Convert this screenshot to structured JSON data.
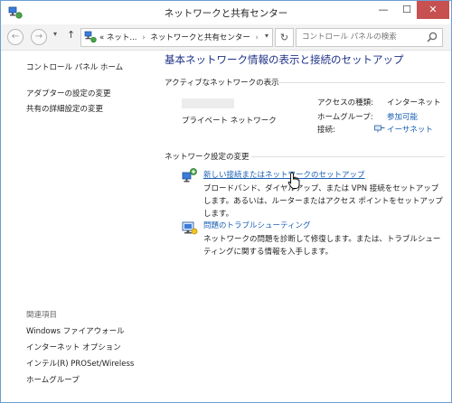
{
  "window": {
    "title": "ネットワークと共有センター",
    "minimize": "—",
    "maximize": "☐",
    "close": "✕"
  },
  "addressbar": {
    "back": "←",
    "forward": "→",
    "recent": "▾",
    "up": "↑",
    "path_prefix": "«",
    "path_segments": [
      "ネット...",
      "ネットワークと共有センター"
    ],
    "path_separator": "›",
    "path_dropdown": "▾",
    "refresh": "↻",
    "search_placeholder": "コントロール パネルの検索"
  },
  "sidebar": {
    "home": "コントロール パネル ホーム",
    "links": [
      "アダプターの設定の変更",
      "共有の詳細設定の変更"
    ],
    "related_heading": "関連項目",
    "related": [
      "Windows ファイアウォール",
      "インターネット オプション",
      "インテル(R) PROSet/Wireless",
      "ホームグループ"
    ]
  },
  "main": {
    "title": "基本ネットワーク情報の表示と接続のセットアップ",
    "active_heading": "アクティブなネットワークの表示",
    "network_type": "プライベート ネットワーク",
    "access_type_label": "アクセスの種類:",
    "access_type_value": "インターネット",
    "homegroup_label": "ホームグループ:",
    "homegroup_value": "参加可能",
    "connection_label": "接続:",
    "connection_value": "イーサネット",
    "change_heading": "ネットワーク設定の変更",
    "tasks": [
      {
        "label": "新しい接続またはネットワークのセットアップ",
        "desc": "ブロードバンド、ダイヤルアップ、または VPN 接続をセットアップします。あるいは、ルーターまたはアクセス ポイントをセットアップします。"
      },
      {
        "label": "問題のトラブルシューティング",
        "desc": "ネットワークの問題を診断して修復します。または、トラブルシューティングに関する情報を入手します。"
      }
    ]
  },
  "colors": {
    "title_blue": "#1e3287",
    "link_blue": "#1a5fb4",
    "close_red": "#c75050"
  }
}
